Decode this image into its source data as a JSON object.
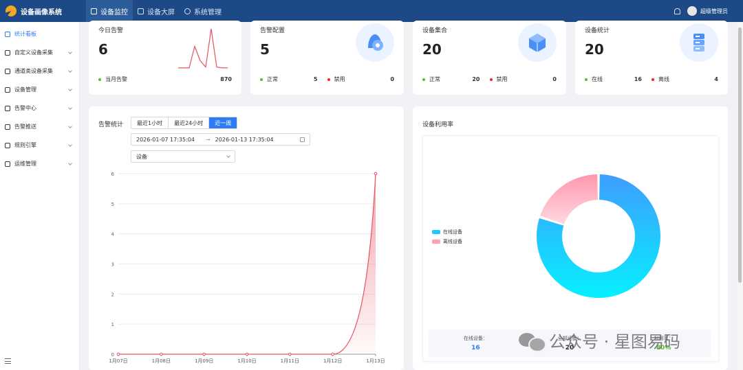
{
  "app": {
    "title": "设备画像系统"
  },
  "topnav": [
    {
      "label": "设备监控",
      "icon": "monitor-icon",
      "active": true
    },
    {
      "label": "设备大屏",
      "icon": "screen-icon",
      "active": false
    },
    {
      "label": "系统管理",
      "icon": "gear-icon",
      "active": false
    }
  ],
  "user": {
    "name": "超级管理员"
  },
  "sidebar": {
    "items": [
      {
        "label": "统计看板",
        "active": true,
        "expandable": false
      },
      {
        "label": "自定义设备采集",
        "active": false,
        "expandable": true
      },
      {
        "label": "通道类设备采集",
        "active": false,
        "expandable": true
      },
      {
        "label": "设备管理",
        "active": false,
        "expandable": true
      },
      {
        "label": "告警中心",
        "active": false,
        "expandable": true
      },
      {
        "label": "告警推送",
        "active": false,
        "expandable": true
      },
      {
        "label": "规则引擎",
        "active": false,
        "expandable": true
      },
      {
        "label": "运维管理",
        "active": false,
        "expandable": true
      }
    ]
  },
  "cards": {
    "today_alarm": {
      "title": "今日告警",
      "value": "6",
      "foot_label": "当月告警",
      "foot_value": "870",
      "spark": [
        1,
        1,
        1,
        28,
        10,
        2,
        50,
        2,
        1,
        1
      ]
    },
    "alarm_config": {
      "title": "告警配置",
      "value": "5",
      "ok_label": "正常",
      "ok_value": "5",
      "off_label": "禁用",
      "off_value": "0"
    },
    "device_set": {
      "title": "设备集合",
      "value": "20",
      "ok_label": "正常",
      "ok_value": "20",
      "off_label": "禁用",
      "off_value": "0"
    },
    "device_stat": {
      "title": "设备统计",
      "value": "20",
      "ok_label": "在线",
      "ok_value": "16",
      "off_label": "离线",
      "off_value": "4"
    }
  },
  "alarm_stats": {
    "title": "告警统计",
    "ranges": [
      {
        "label": "最近1小时",
        "active": false
      },
      {
        "label": "最近24小时",
        "active": false
      },
      {
        "label": "近一周",
        "active": true
      }
    ],
    "date_start": "2026-01-07 17:35:04",
    "date_end": "2026-01-13 17:35:04",
    "range_sep": "→",
    "select_value": "设备"
  },
  "utilization": {
    "title": "设备利用率",
    "legend": [
      {
        "label": "在线设备",
        "color": "#1ec8ff"
      },
      {
        "label": "离线设备",
        "color": "#ff9fb1"
      }
    ],
    "stats": [
      {
        "label": "在线设备：",
        "value": "16",
        "tone": "blue"
      },
      {
        "label": "全部设备：",
        "value": "20",
        "tone": "dark"
      },
      {
        "label": "利用率：",
        "value": "80%",
        "tone": "green"
      }
    ]
  },
  "watermark": {
    "text": "公众号 · 星图易码"
  },
  "chart_data": [
    {
      "type": "area",
      "categories": [
        "1月07日",
        "1月08日",
        "1月09日",
        "1月10日",
        "1月11日",
        "1月12日",
        "1月13日"
      ],
      "values": [
        0,
        0,
        0,
        0,
        0,
        0,
        6
      ],
      "ylim": [
        0,
        6
      ],
      "yticks": [
        0,
        1,
        2,
        3,
        4,
        5,
        6
      ],
      "grid": true,
      "color": "#e8525f"
    },
    {
      "type": "pie",
      "labels": [
        "在线设备",
        "离线设备"
      ],
      "values": [
        16,
        4
      ],
      "colors": [
        "#1ec8ff",
        "#ff9fb1"
      ],
      "legend": "left"
    }
  ]
}
